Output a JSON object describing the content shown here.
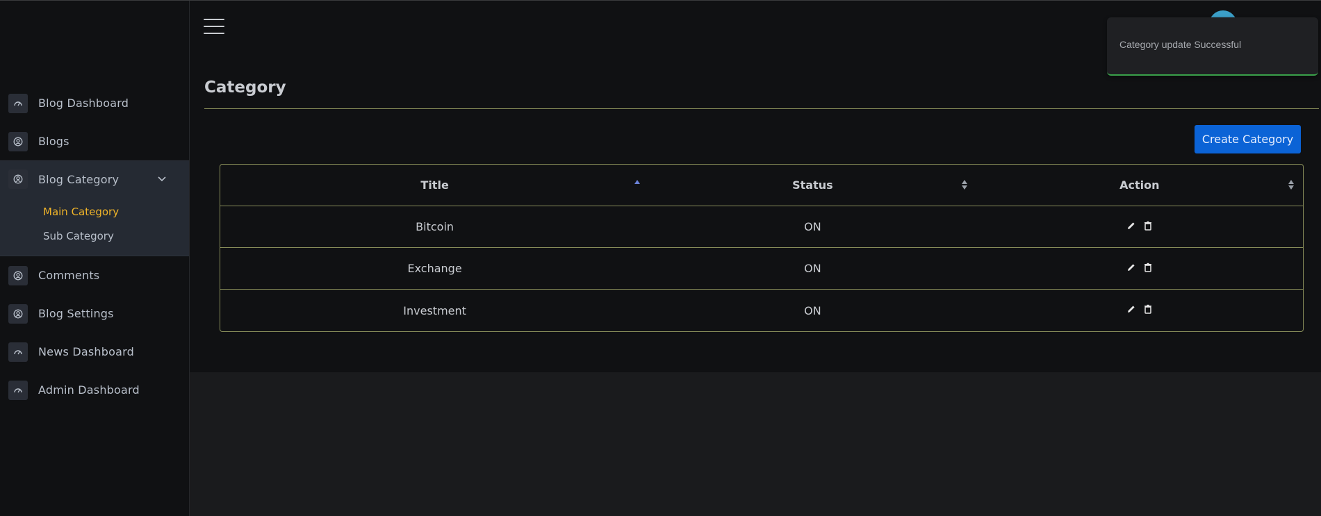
{
  "sidebar": {
    "items": [
      {
        "label": "Blog Dashboard",
        "icon": "speedometer-icon"
      },
      {
        "label": "Blogs",
        "icon": "user-circle-icon"
      },
      {
        "label": "Blog Category",
        "icon": "user-circle-icon",
        "expanded": true,
        "children": [
          {
            "label": "Main Category",
            "active": true
          },
          {
            "label": "Sub Category",
            "active": false
          }
        ]
      },
      {
        "label": "Comments",
        "icon": "user-circle-icon"
      },
      {
        "label": "Blog Settings",
        "icon": "user-circle-icon"
      },
      {
        "label": "News Dashboard",
        "icon": "speedometer-icon"
      },
      {
        "label": "Admin Dashboard",
        "icon": "speedometer-icon"
      }
    ]
  },
  "page": {
    "title": "Category",
    "create_button": "Create Category"
  },
  "table": {
    "columns": [
      "Title",
      "Status",
      "Action"
    ],
    "sort": {
      "column": "Title",
      "direction": "asc"
    },
    "rows": [
      {
        "title": "Bitcoin",
        "status": "ON"
      },
      {
        "title": "Exchange",
        "status": "ON"
      },
      {
        "title": "Investment",
        "status": "ON"
      }
    ]
  },
  "toast": {
    "message": "Category update Successful"
  },
  "colors": {
    "accent": "#0b63d6",
    "active_submenu": "#f0b429",
    "toast_success": "#3aa04a",
    "divider": "#8a8f5a"
  }
}
